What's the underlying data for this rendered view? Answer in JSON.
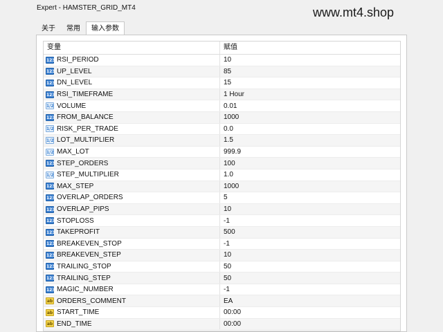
{
  "window": {
    "title": "Expert - HAMSTER_GRID_MT4"
  },
  "watermark": "www.mt4.shop",
  "tabs": [
    {
      "label": "关于"
    },
    {
      "label": "常用"
    },
    {
      "label": "输入参数"
    }
  ],
  "table": {
    "col_variable": "变量",
    "col_value": "赋值",
    "rows": [
      {
        "icon": "int",
        "name": "RSI_PERIOD",
        "value": "10"
      },
      {
        "icon": "int",
        "name": "UP_LEVEL",
        "value": "85"
      },
      {
        "icon": "int",
        "name": "DN_LEVEL",
        "value": "15"
      },
      {
        "icon": "int",
        "name": "RSI_TIMEFRAME",
        "value": "1 Hour"
      },
      {
        "icon": "dbl",
        "name": "VOLUME",
        "value": "0.01"
      },
      {
        "icon": "int",
        "name": "FROM_BALANCE",
        "value": "1000"
      },
      {
        "icon": "dbl",
        "name": "RISK_PER_TRADE",
        "value": "0.0"
      },
      {
        "icon": "dbl",
        "name": "LOT_MULTIPLIER",
        "value": "1.5"
      },
      {
        "icon": "dbl",
        "name": "MAX_LOT",
        "value": "999.9"
      },
      {
        "icon": "int",
        "name": "STEP_ORDERS",
        "value": "100"
      },
      {
        "icon": "dbl",
        "name": "STEP_MULTIPLIER",
        "value": "1.0"
      },
      {
        "icon": "int",
        "name": "MAX_STEP",
        "value": "1000"
      },
      {
        "icon": "int",
        "name": "OVERLAP_ORDERS",
        "value": "5"
      },
      {
        "icon": "int",
        "name": "OVERLAP_PIPS",
        "value": "10"
      },
      {
        "icon": "int",
        "name": "STOPLOSS",
        "value": "-1"
      },
      {
        "icon": "int",
        "name": "TAKEPROFIT",
        "value": "500"
      },
      {
        "icon": "int",
        "name": "BREAKEVEN_STOP",
        "value": "-1"
      },
      {
        "icon": "int",
        "name": "BREAKEVEN_STEP",
        "value": "10"
      },
      {
        "icon": "int",
        "name": "TRAILING_STOP",
        "value": "50"
      },
      {
        "icon": "int",
        "name": "TRAILING_STEP",
        "value": "50"
      },
      {
        "icon": "int",
        "name": "MAGIC_NUMBER",
        "value": "-1"
      },
      {
        "icon": "str",
        "name": "ORDERS_COMMENT",
        "value": "EA"
      },
      {
        "icon": "str",
        "name": "START_TIME",
        "value": "00:00"
      },
      {
        "icon": "str",
        "name": "END_TIME",
        "value": "00:00"
      }
    ]
  }
}
